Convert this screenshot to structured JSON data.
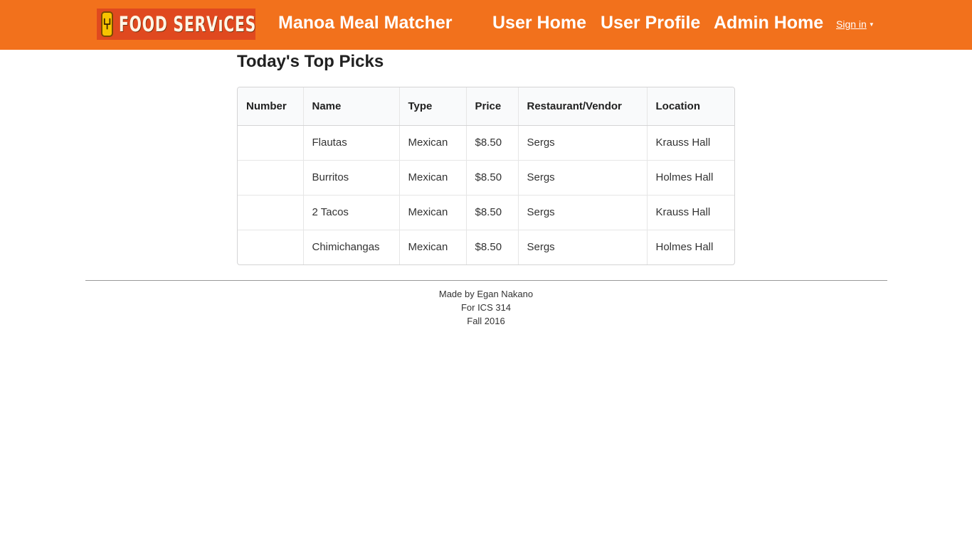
{
  "header": {
    "logo_text": "FOOD SERVıCES",
    "app_title": "Manoa Meal Matcher",
    "nav": [
      "User Home",
      "User Profile",
      "Admin Home"
    ],
    "signin_label": "Sign in",
    "brand_color": "#f2711c"
  },
  "main": {
    "title": "Today's Top Picks",
    "table": {
      "columns": [
        "Number",
        "Name",
        "Type",
        "Price",
        "Restaurant/Vendor",
        "Location"
      ],
      "rows": [
        [
          "",
          "Flautas",
          "Mexican",
          "$8.50",
          "Sergs",
          "Krauss Hall"
        ],
        [
          "",
          "Burritos",
          "Mexican",
          "$8.50",
          "Sergs",
          "Holmes Hall"
        ],
        [
          "",
          "2 Tacos",
          "Mexican",
          "$8.50",
          "Sergs",
          "Krauss Hall"
        ],
        [
          "",
          "Chimichangas",
          "Mexican",
          "$8.50",
          "Sergs",
          "Holmes Hall"
        ]
      ]
    }
  },
  "footer": {
    "lines": [
      "Made by Egan Nakano",
      "For ICS 314",
      "Fall 2016"
    ]
  }
}
